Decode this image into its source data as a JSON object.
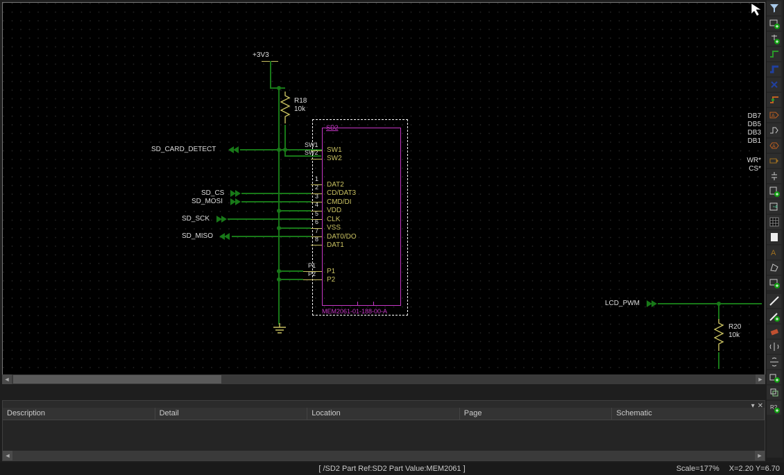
{
  "power": {
    "rail": "+3V3"
  },
  "r18": {
    "ref": "R18",
    "val": "10k"
  },
  "r20": {
    "ref": "R20",
    "val": "10k"
  },
  "signals": {
    "sd_detect": "SD_CARD_DETECT",
    "sd_cs": "SD_CS",
    "sd_mosi": "SD_MOSI",
    "sd_sck": "SD_SCK",
    "sd_miso": "SD_MISO",
    "lcd_pwm": "LCD_PWM"
  },
  "sd2": {
    "ref": "SD2",
    "value": "MEM2061-01-188-00-A",
    "sw1_ext": "SW1",
    "sw2_ext": "SW2",
    "pins_int": {
      "sw1": "SW1",
      "sw2": "SW2",
      "dat2": "DAT2",
      "cddat3": "CD/DAT3",
      "cmd": "CMD/DI",
      "vdd": "VDD",
      "clk": "CLK",
      "vss": "VSS",
      "dat0": "DAT0/DO",
      "dat1": "DAT1",
      "p1": "P1",
      "p2": "P2"
    },
    "pinnum": {
      "n1": "1",
      "n2": "2",
      "n3": "3",
      "n4": "4",
      "n5": "5",
      "n6": "6",
      "n7": "7",
      "n8": "8",
      "p1e": "P1",
      "p2e": "P2"
    }
  },
  "east_labels": {
    "db7": "DB7",
    "db5": "DB5",
    "db3": "DB3",
    "db1": "DB1",
    "wr": "WR*",
    "cs": "CS*"
  },
  "bottom": {
    "c1": "Description",
    "c2": "Detail",
    "c3": "Location",
    "c4": "Page",
    "c5": "Schematic"
  },
  "statusbar": {
    "center": "[ /SD2 Part Ref:SD2 Part Value:MEM2061 ]",
    "scale": "Scale=177%",
    "coords": "X=2.20  Y=6.70"
  }
}
